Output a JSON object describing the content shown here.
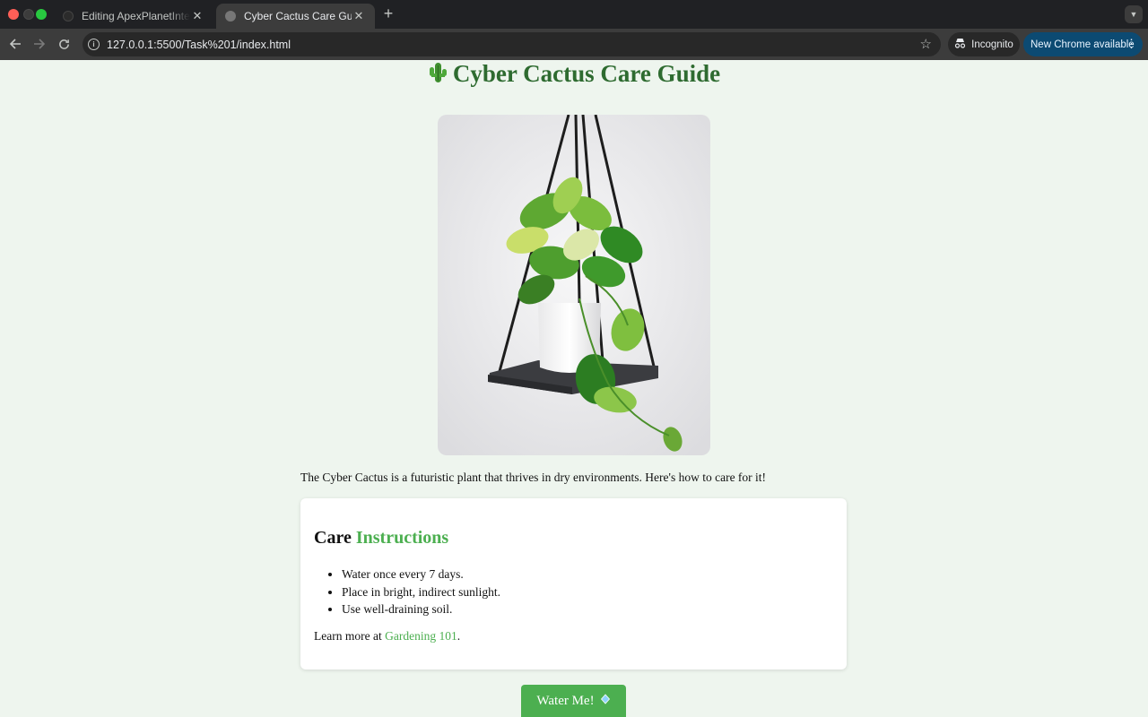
{
  "browser": {
    "tabs": [
      {
        "title": "Editing ApexPlanetInternship/",
        "active": false
      },
      {
        "title": "Cyber Cactus Care Guide",
        "active": true
      }
    ],
    "url": "127.0.0.1:5500/Task%201/index.html",
    "incognito_label": "Incognito",
    "update_label": "New Chrome available"
  },
  "page": {
    "title": "Cyber Cactus Care Guide",
    "image_alt": "Hanging potted pothos plant",
    "intro": "The Cyber Cactus is a futuristic plant that thrives in dry environments. Here's how to care for it!",
    "care": {
      "heading_word1": "Care",
      "heading_word2": "Instructions",
      "items": [
        "Water once every 7 days.",
        "Place in bright, indirect sunlight.",
        "Use well-draining soil."
      ],
      "learn_prefix": "Learn more at",
      "link_text": "Gardening 101",
      "learn_suffix": "."
    },
    "button_label": "Water Me!"
  },
  "colors": {
    "accent_green": "#4caf50",
    "title_green": "#2e6b30",
    "page_bg": "#eef5ee",
    "chrome_dark": "#202124",
    "chrome_toolbar": "#3c3c3c",
    "update_blue": "#0c4a72"
  },
  "icons": [
    "back-arrow-icon",
    "forward-arrow-icon",
    "reload-icon",
    "info-icon",
    "star-icon",
    "incognito-icon",
    "cactus-icon",
    "water-drop-icon"
  ]
}
